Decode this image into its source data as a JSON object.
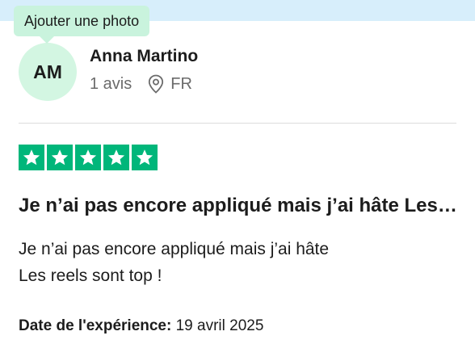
{
  "tooltip": {
    "text": "Ajouter une photo"
  },
  "reviewer": {
    "initials": "AM",
    "name": "Anna Martino",
    "review_count": "1 avis",
    "country": "FR",
    "location_icon": "map-pin-icon"
  },
  "review": {
    "rating": 5,
    "max_rating": 5,
    "star_color": "#00b67a",
    "title": "Je n’ai pas encore appliqué mais j’ai hâte Les reels sont top !",
    "body_lines": [
      "Je n’ai pas encore appliqué mais j’ai hâte",
      "Les reels sont top !"
    ],
    "experience_label": "Date de l'expérience:",
    "experience_date": "19 avril 2025"
  },
  "colors": {
    "top_band": "#d7eefb",
    "tooltip_bg": "#c9f3dd",
    "avatar_bg": "#d3f6e2",
    "muted_text": "#6b6b6b"
  }
}
